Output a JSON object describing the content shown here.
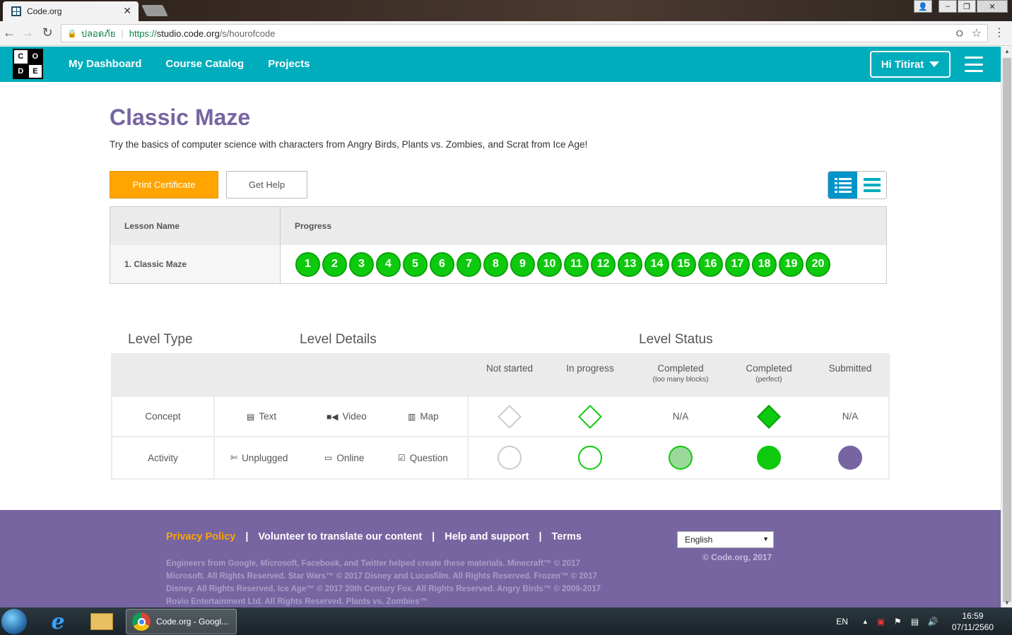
{
  "browser": {
    "tab_title": "Code.org",
    "url_secure_label": "ปลอดภัย",
    "url_scheme": "https://",
    "url_host": "studio.code.org",
    "url_path": "/s/hourofcode"
  },
  "site_header": {
    "logo_letters": [
      "C",
      "O",
      "D",
      "E"
    ],
    "nav": [
      "My Dashboard",
      "Course Catalog",
      "Projects"
    ],
    "user_label": "Hi Titirat"
  },
  "page": {
    "title": "Classic Maze",
    "description": "Try the basics of computer science with characters from Angry Birds, Plants vs. Zombies, and Scrat from Ice Age!",
    "print_certificate": "Print Certificate",
    "get_help": "Get Help"
  },
  "lessons_table": {
    "headers": [
      "Lesson Name",
      "Progress"
    ],
    "rows": [
      {
        "name": "1. Classic Maze",
        "levels": [
          "1",
          "2",
          "3",
          "4",
          "5",
          "6",
          "7",
          "8",
          "9",
          "10",
          "11",
          "12",
          "13",
          "14",
          "15",
          "16",
          "17",
          "18",
          "19",
          "20"
        ]
      }
    ]
  },
  "legend": {
    "titles": [
      "Level Type",
      "Level Details",
      "Level Status"
    ],
    "status_headers": [
      {
        "label": "Not started",
        "sub": ""
      },
      {
        "label": "In progress",
        "sub": ""
      },
      {
        "label": "Completed",
        "sub": "(too many blocks)"
      },
      {
        "label": "Completed",
        "sub": "(perfect)"
      },
      {
        "label": "Submitted",
        "sub": ""
      }
    ],
    "rows": [
      {
        "type": "Concept",
        "details": [
          {
            "icon": "document-icon",
            "label": "Text"
          },
          {
            "icon": "video-camera-icon",
            "label": "Video"
          },
          {
            "icon": "map-icon",
            "label": "Map"
          }
        ],
        "status": [
          "",
          "",
          "N/A",
          "",
          "N/A"
        ]
      },
      {
        "type": "Activity",
        "details": [
          {
            "icon": "scissors-icon",
            "label": "Unplugged"
          },
          {
            "icon": "desktop-icon",
            "label": "Online"
          },
          {
            "icon": "checkbox-icon",
            "label": "Question"
          }
        ],
        "status": [
          "",
          "",
          "",
          "",
          ""
        ]
      }
    ]
  },
  "footer": {
    "links": [
      "Privacy Policy",
      "Volunteer to translate our content",
      "Help and support",
      "Terms"
    ],
    "legal": "Engineers from Google, Microsoft, Facebook, and Twitter helped create these materials. Minecraft™ © 2017 Microsoft. All Rights Reserved. Star Wars™ © 2017 Disney and Lucasfilm. All Rights Reserved. Frozen™ © 2017 Disney. All Rights Reserved. Ice Age™ © 2017 20th Century Fox. All Rights Reserved. Angry Birds™ © 2009-2017 Rovio Entertainment Ltd. All Rights Reserved. Plants vs. Zombies™",
    "language": "English",
    "copyright": "© Code.org, 2017"
  },
  "taskbar": {
    "chrome_label": "Code.org - Googl...",
    "lang": "EN",
    "time": "16:59",
    "date": "07/11/2560"
  },
  "colors": {
    "brand_teal": "#00adbc",
    "brand_purple": "#7665a0",
    "accent_orange": "#ffa400",
    "progress_green": "#0eca0e",
    "light_green": "#9bd99b"
  }
}
